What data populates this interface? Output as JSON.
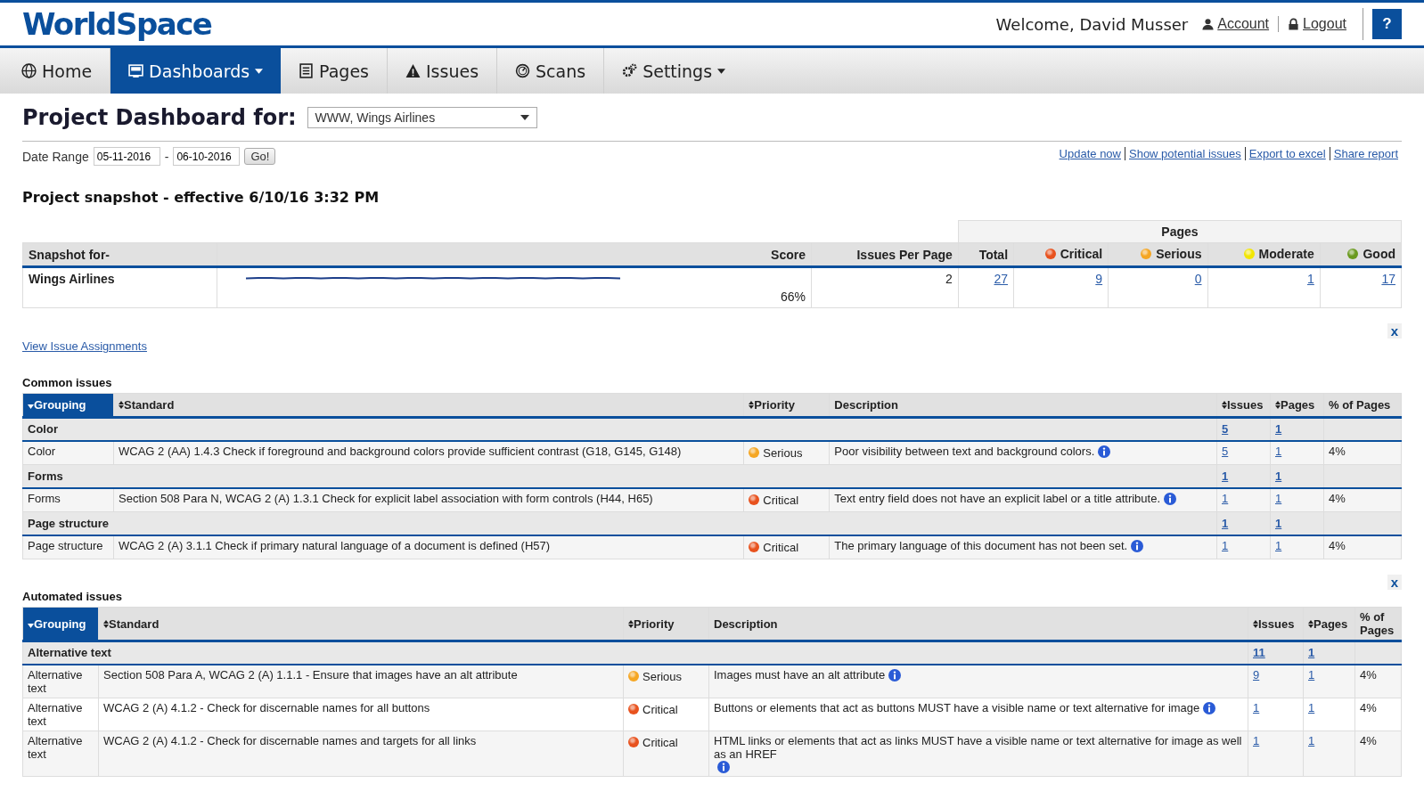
{
  "header": {
    "logo": "WorldSpace",
    "welcome": "Welcome, David Musser",
    "links": [
      {
        "label": "Account"
      },
      {
        "label": "Logout"
      }
    ],
    "help": "?"
  },
  "nav": [
    {
      "label": "Home",
      "selected": false,
      "dropdown": false
    },
    {
      "label": "Dashboards",
      "selected": true,
      "dropdown": true
    },
    {
      "label": "Pages",
      "selected": false,
      "dropdown": false
    },
    {
      "label": "Issues",
      "selected": false,
      "dropdown": false
    },
    {
      "label": "Scans",
      "selected": false,
      "dropdown": false
    },
    {
      "label": "Settings",
      "selected": false,
      "dropdown": true
    }
  ],
  "title": "Project Dashboard for:",
  "project_select": "WWW, Wings Airlines",
  "date_range": {
    "label": "Date Range",
    "from": "05-11-2016",
    "separator": "-",
    "to": "06-10-2016",
    "go": "Go!"
  },
  "actions": [
    "Update now",
    "Show potential issues",
    "Export to excel",
    "Share report"
  ],
  "snapshot_title": "Project snapshot - effective 6/10/16 3:32 PM",
  "snapshot": {
    "group_header": "Pages",
    "columns": [
      {
        "label": "Snapshot for-"
      },
      {
        "label": "Score"
      },
      {
        "label": "Issues Per Page"
      },
      {
        "label": "Total"
      },
      {
        "label": "Critical",
        "color": "#e8521e"
      },
      {
        "label": "Serious",
        "color": "#f5a623"
      },
      {
        "label": "Moderate",
        "color": "#f2e600"
      },
      {
        "label": "Good",
        "color": "#6a9a1f"
      }
    ],
    "row": {
      "name": "Wings Airlines",
      "score": "66%",
      "issues_per_page": "2",
      "counts": [
        "27",
        "9",
        "0",
        "1",
        "17"
      ]
    }
  },
  "close_label": "x",
  "assignments_link": "View Issue Assignments",
  "issue_tables": [
    {
      "title": "Common issues",
      "columns": [
        {
          "label": "Grouping",
          "sortable": true,
          "sorted": true
        },
        {
          "label": "Standard",
          "sortable": true,
          "sorted": false
        },
        {
          "label": "Priority",
          "sortable": true,
          "sorted": false
        },
        {
          "label": "Description",
          "sortable": false,
          "sorted": false
        },
        {
          "label": "Issues",
          "sortable": true,
          "sorted": false
        },
        {
          "label": "Pages",
          "sortable": true,
          "sorted": false
        },
        {
          "label": "% of Pages",
          "sortable": false,
          "sorted": false
        }
      ],
      "groups": [
        {
          "name": "Color",
          "issues": "5",
          "pages": "1",
          "rows": [
            {
              "grouping": "Color",
              "standard": "WCAG 2 (AA) 1.4.3 Check if foreground and background colors provide sufficient contrast (G18, G145, G148)",
              "priority": {
                "label": "Serious",
                "color": "#f5a623"
              },
              "description": "Poor visibility between text and background colors.",
              "issues": "5",
              "pages": "1",
              "percent": "4%"
            }
          ]
        },
        {
          "name": "Forms",
          "issues": "1",
          "pages": "1",
          "rows": [
            {
              "grouping": "Forms",
              "standard": "Section 508 Para N, WCAG 2 (A) 1.3.1 Check for explicit label association with form controls (H44, H65)",
              "priority": {
                "label": "Critical",
                "color": "#e8521e"
              },
              "description": "Text entry field does not have an explicit label or a title attribute.",
              "issues": "1",
              "pages": "1",
              "percent": "4%"
            }
          ]
        },
        {
          "name": "Page structure",
          "issues": "1",
          "pages": "1",
          "rows": [
            {
              "grouping": "Page structure",
              "standard": "WCAG 2 (A) 3.1.1 Check if primary natural language of a document is defined (H57)",
              "priority": {
                "label": "Critical",
                "color": "#e8521e"
              },
              "description": "The primary language of this document has not been set.",
              "issues": "1",
              "pages": "1",
              "percent": "4%"
            }
          ]
        }
      ]
    },
    {
      "title": "Automated issues",
      "close_label": "x",
      "columns": [
        {
          "label": "Grouping",
          "sortable": true,
          "sorted": true
        },
        {
          "label": "Standard",
          "sortable": true,
          "sorted": false
        },
        {
          "label": "Priority",
          "sortable": true,
          "sorted": false
        },
        {
          "label": "Description",
          "sortable": false,
          "sorted": false
        },
        {
          "label": "Issues",
          "sortable": true,
          "sorted": false
        },
        {
          "label": "Pages",
          "sortable": true,
          "sorted": false
        },
        {
          "label": "% of Pages",
          "sortable": false,
          "sorted": false
        }
      ],
      "groups": [
        {
          "name": "Alternative text",
          "issues": "11",
          "pages": "1",
          "rows": [
            {
              "grouping": "Alternative text",
              "standard": "Section 508 Para A, WCAG 2 (A) 1.1.1 - Ensure that images have an alt attribute",
              "priority": {
                "label": "Serious",
                "color": "#f5a623"
              },
              "description": "Images must have an alt attribute",
              "issues": "9",
              "pages": "1",
              "percent": "4%"
            },
            {
              "grouping": "Alternative text",
              "standard": "WCAG 2 (A) 4.1.2 - Check for discernable names for all buttons",
              "priority": {
                "label": "Critical",
                "color": "#e8521e"
              },
              "description": "Buttons or elements that act as buttons MUST have a visible name or text alternative for image",
              "issues": "1",
              "pages": "1",
              "percent": "4%"
            },
            {
              "grouping": "Alternative text",
              "standard": "WCAG 2 (A) 4.1.2 - Check for discernable names and targets for all links",
              "priority": {
                "label": "Critical",
                "color": "#e8521e"
              },
              "description": "HTML links or elements that act as links MUST have a visible name or text alternative for image as well as an HREF",
              "issues": "1",
              "pages": "1",
              "percent": "4%"
            }
          ]
        }
      ]
    }
  ]
}
